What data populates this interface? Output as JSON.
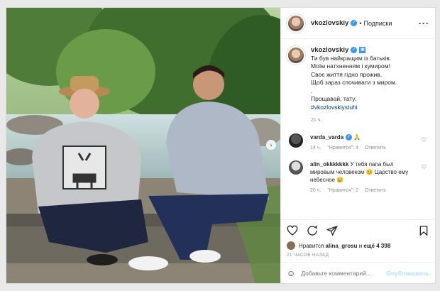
{
  "post": {
    "username": "vkozlovskiy",
    "follow_label": "Подписки",
    "caption_lines": [
      "Ти був найкращим із батьків.",
      "Моїм натхненням і кумиром!",
      "Своє життя гідно прожив.",
      "Щоб зараз спочивати з миром.",
      ".",
      "Прощавай, тату."
    ],
    "hashtag": "#vkozlovskiystuhi",
    "caption_time": "21 ч."
  },
  "comments": [
    {
      "username": "varda_varda",
      "text": "🙏",
      "time": "14 ч.",
      "likes": "\"Нравится\": 4",
      "reply": "Ответить"
    },
    {
      "username": "alin_okkkkkkk",
      "text": "У тебя папа был мировым человеком 😊 Царство ему небесное 😢",
      "time": "20 ч.",
      "likes": "\"Нравится\": 2",
      "reply": "Ответить"
    }
  ],
  "likes_line": {
    "prefix": "Нравится",
    "user": "alina_grosu",
    "middle": "и",
    "count": "ещё 4 398"
  },
  "posted_ago": "21 ЧАСОВ НАЗАД",
  "add_comment": {
    "placeholder": "Добавьте комментарий...",
    "post_label": "Опубликовать"
  },
  "icons": {
    "like": "heart-icon",
    "comment": "comment-icon",
    "share": "share-icon",
    "save": "bookmark-icon",
    "emoji": "emoji-icon",
    "more": "more-icon"
  },
  "colors": {
    "verified": "#3897f0",
    "link": "#00376b",
    "post_disabled": "#b2dffc"
  }
}
